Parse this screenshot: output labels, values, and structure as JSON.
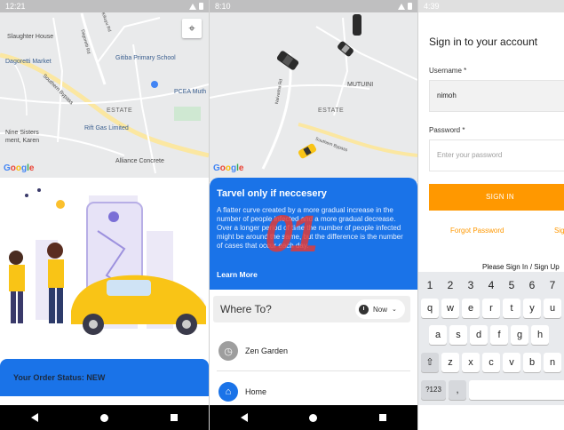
{
  "screens": [
    {
      "status": {
        "time": "12:21"
      },
      "map": {
        "labels": [
          "Slaughter House",
          "Dagoretti Market",
          "Gitiba Primary School",
          "PCEA Muth",
          "ESTATE",
          "Nine Sisters",
          "ment, Karen",
          "Rift Gas Limited",
          "Alliance Concrete",
          "Southern Bypass",
          "Dagoretti Rd",
          "Kikuyu Rd"
        ]
      },
      "order_status": "Your Order Status: NEW",
      "icons": {
        "locate": "my-location-icon"
      }
    },
    {
      "status": {
        "time": "8:10"
      },
      "map": {
        "labels": [
          "MUTUINI",
          "ESTATE",
          "Southern Bypass",
          "Naivasha Rd"
        ]
      },
      "promo": {
        "title": "Tarvel only if neccesery",
        "body": "A flatter curve created by a more gradual increase in the number of people infected and a more gradual decrease. Over a longer period of time the number of people infected might be around the same, but the difference is the number of cases that occur each day.",
        "link": "Learn More"
      },
      "watermark": "01",
      "where_to": {
        "label": "Where To?",
        "time_option": "Now"
      },
      "places": [
        {
          "label": "Zen Garden",
          "icon": "clock-icon"
        },
        {
          "label": "Home",
          "icon": "home-icon"
        }
      ]
    },
    {
      "status": {
        "time": "4:39"
      },
      "title": "Sign in to your account",
      "username": {
        "label": "Username *",
        "value": "nimoh"
      },
      "password": {
        "label": "Password *",
        "placeholder": "Enter your password"
      },
      "signin_label": "SIGN IN",
      "forgot_label": "Forgot Password",
      "signup_cut_label": "Sig",
      "please_text": "Please Sign In / Sign Up",
      "keyboard": {
        "numbers": [
          "1",
          "2",
          "3",
          "4",
          "5",
          "6",
          "7"
        ],
        "row1": [
          "q",
          "w",
          "e",
          "r",
          "t",
          "y",
          "u"
        ],
        "row2": [
          "a",
          "s",
          "d",
          "f",
          "g",
          "h"
        ],
        "row3": [
          "z",
          "x",
          "c",
          "v",
          "b",
          "n"
        ],
        "mode_key": "?123",
        "comma_key": ","
      }
    }
  ],
  "google_letters": [
    "G",
    "o",
    "o",
    "g",
    "l",
    "e"
  ],
  "colors": {
    "primary_blue": "#1a73e8",
    "orange": "#ff9800",
    "map_bg": "#e9eaeb",
    "taxi_yellow": "#f9c416"
  }
}
